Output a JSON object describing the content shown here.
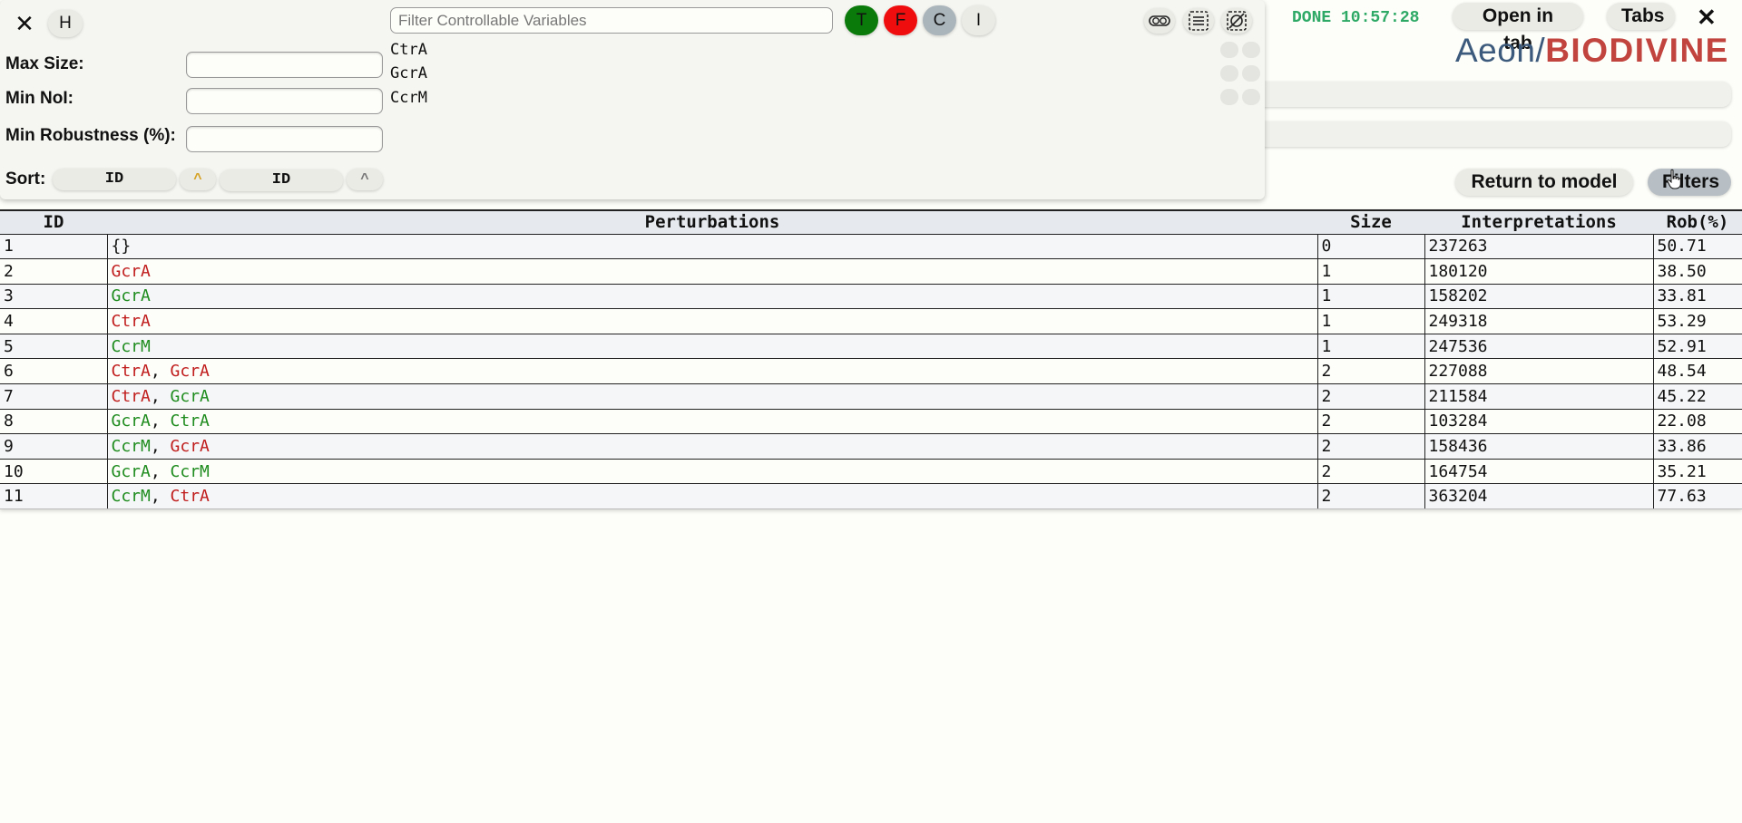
{
  "header": {
    "status": "DONE 10:57:28",
    "open_in_tab_label": "Open in tab",
    "tabs_label": "Tabs",
    "close_label": "✕",
    "logo_aeon": "Aeon",
    "logo_slash": "/",
    "logo_biodivine": "BIODIVINE"
  },
  "actions": {
    "return_label": "Return to model",
    "filters_label": "Filters"
  },
  "filter_panel": {
    "close_label": "✕",
    "h_label": "H",
    "max_size_label": "Max Size:",
    "min_noi_label": "Min NoI:",
    "min_robustness_label": "Min Robustness (%):",
    "sort_label": "Sort:",
    "sort_key_1": "ID",
    "sort_dir_1": "^",
    "sort_key_2": "ID",
    "sort_dir_2": "^",
    "search_placeholder": "Filter Controllable Variables",
    "t_label": "T",
    "f_label": "F",
    "c_label": "C",
    "i_label": "I",
    "variables": [
      "CtrA",
      "GcrA",
      "CcrM"
    ]
  },
  "colors": {
    "true_green": "#0a7a0a",
    "false_red": "#ef0d0d",
    "status_green": "#2eaa66"
  },
  "table": {
    "columns": [
      "ID",
      "Perturbations",
      "Size",
      "Interpretations",
      "Rob(%)"
    ],
    "rows": [
      {
        "id": "1",
        "perturbations": [
          {
            "name": "{}",
            "state": "none"
          }
        ],
        "size": "0",
        "interpretations": "237263",
        "rob": "50.71"
      },
      {
        "id": "2",
        "perturbations": [
          {
            "name": "GcrA",
            "state": "false"
          }
        ],
        "size": "1",
        "interpretations": "180120",
        "rob": "38.50"
      },
      {
        "id": "3",
        "perturbations": [
          {
            "name": "GcrA",
            "state": "true"
          }
        ],
        "size": "1",
        "interpretations": "158202",
        "rob": "33.81"
      },
      {
        "id": "4",
        "perturbations": [
          {
            "name": "CtrA",
            "state": "false"
          }
        ],
        "size": "1",
        "interpretations": "249318",
        "rob": "53.29"
      },
      {
        "id": "5",
        "perturbations": [
          {
            "name": "CcrM",
            "state": "true"
          }
        ],
        "size": "1",
        "interpretations": "247536",
        "rob": "52.91"
      },
      {
        "id": "6",
        "perturbations": [
          {
            "name": "CtrA",
            "state": "false"
          },
          {
            "name": "GcrA",
            "state": "false"
          }
        ],
        "size": "2",
        "interpretations": "227088",
        "rob": "48.54"
      },
      {
        "id": "7",
        "perturbations": [
          {
            "name": "CtrA",
            "state": "false"
          },
          {
            "name": "GcrA",
            "state": "true"
          }
        ],
        "size": "2",
        "interpretations": "211584",
        "rob": "45.22"
      },
      {
        "id": "8",
        "perturbations": [
          {
            "name": "GcrA",
            "state": "true"
          },
          {
            "name": "CtrA",
            "state": "true"
          }
        ],
        "size": "2",
        "interpretations": "103284",
        "rob": "22.08"
      },
      {
        "id": "9",
        "perturbations": [
          {
            "name": "CcrM",
            "state": "true"
          },
          {
            "name": "GcrA",
            "state": "false"
          }
        ],
        "size": "2",
        "interpretations": "158436",
        "rob": "33.86"
      },
      {
        "id": "10",
        "perturbations": [
          {
            "name": "GcrA",
            "state": "true"
          },
          {
            "name": "CcrM",
            "state": "true"
          }
        ],
        "size": "2",
        "interpretations": "164754",
        "rob": "35.21"
      },
      {
        "id": "11",
        "perturbations": [
          {
            "name": "CcrM",
            "state": "true"
          },
          {
            "name": "CtrA",
            "state": "false"
          }
        ],
        "size": "2",
        "interpretations": "363204",
        "rob": "77.63"
      }
    ]
  }
}
